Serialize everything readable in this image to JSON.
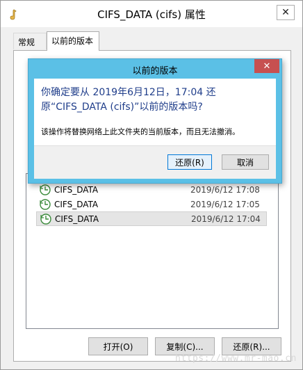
{
  "window": {
    "title": "CIFS_DATA (cifs) 属性",
    "close_glyph": "✕"
  },
  "tabs": [
    {
      "label": "常规"
    },
    {
      "label": "以前的版本"
    }
  ],
  "versions": [
    {
      "name": "CIFS_DATA",
      "date": "2019/6/12 17:08"
    },
    {
      "name": "CIFS_DATA",
      "date": "2019/6/12 17:05"
    },
    {
      "name": "CIFS_DATA",
      "date": "2019/6/12 17:04"
    }
  ],
  "buttons": {
    "open": "打开(O)",
    "copy": "复制(C)...",
    "restore": "还原(R)..."
  },
  "dialog": {
    "title": "以前的版本",
    "close_glyph": "✕",
    "message": "你确定要从 2019年6月12日，17:04 还原“CIFS_DATA (cifs)”以前的版本吗?",
    "detail": "该操作将替换网络上此文件夹的当前版本，而且无法撤消。",
    "restore_label": "还原(R)",
    "cancel_label": "取消"
  },
  "watermark": "https://www.mr-mao.cn"
}
